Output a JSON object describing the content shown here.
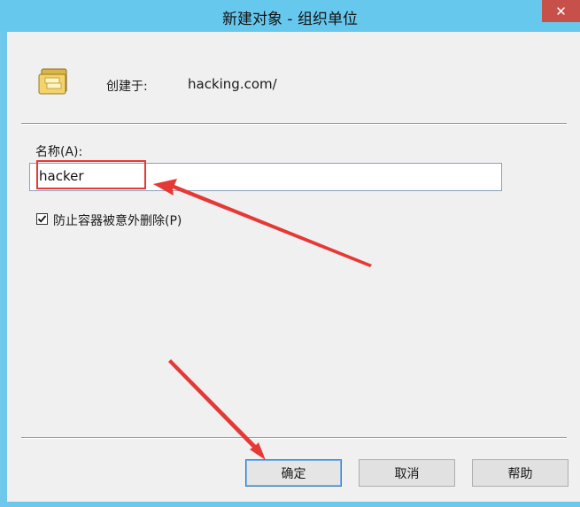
{
  "window": {
    "title": "新建对象 - 组织单位",
    "close_glyph": "✕"
  },
  "header": {
    "icon": "ou-folder-icon",
    "created_in_label": "创建于:",
    "created_in_value": "hacking.com/"
  },
  "form": {
    "name_label": "名称(A):",
    "name_value": "hacker",
    "protect_checkbox": {
      "checked": true,
      "label": "防止容器被意外删除(P)"
    }
  },
  "buttons": {
    "ok": "确定",
    "cancel": "取消",
    "help": "帮助"
  },
  "colors": {
    "title_bar": "#67c8ee",
    "close_button": "#c7504a",
    "annotation": "#e53935"
  }
}
